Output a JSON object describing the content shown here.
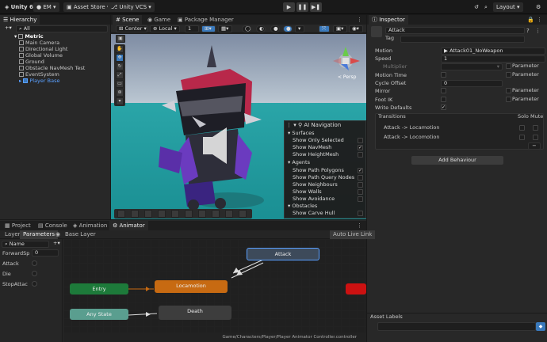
{
  "topbar": {
    "unity": "Unity 6",
    "account": "EM",
    "asset_store": "Asset Store",
    "vcs": "Unity VCS",
    "layout": "Layout"
  },
  "hierarchy": {
    "tab": "Hierarchy",
    "search_placeholder": "All",
    "root": "Metric",
    "items": [
      "Main Camera",
      "Directional Light",
      "Global Volume",
      "Ground",
      "Obstacle NavMesh Test",
      "EventSystem"
    ],
    "selected": "Player Base"
  },
  "scene": {
    "tabs": [
      "Scene",
      "Game",
      "Package Manager"
    ],
    "pivot": "Center",
    "space": "Local",
    "snap": "1",
    "persp": "< Persp"
  },
  "ai_navigation": {
    "title": "AI Navigation",
    "surfaces_header": "Surfaces",
    "surfaces": [
      {
        "label": "Show Only Selected",
        "checked": false
      },
      {
        "label": "Show NavMesh",
        "checked": true
      },
      {
        "label": "Show HeightMesh",
        "checked": false
      }
    ],
    "agents_header": "Agents",
    "agents": [
      {
        "label": "Show Path Polygons",
        "checked": true
      },
      {
        "label": "Show Path Query Nodes",
        "checked": false
      },
      {
        "label": "Show Neighbours",
        "checked": false
      },
      {
        "label": "Show Walls",
        "checked": false
      },
      {
        "label": "Show Avoidance",
        "checked": false
      }
    ],
    "obstacles_header": "Obstacles",
    "obstacles": [
      {
        "label": "Show Carve Hull",
        "checked": false
      }
    ]
  },
  "inspector": {
    "tab": "Inspector",
    "name": "Attack",
    "tag_label": "Tag",
    "motion_label": "Motion",
    "motion_value": "Attack01_NoWeapon",
    "speed_label": "Speed",
    "speed_value": "1",
    "multiplier_label": "Multiplier",
    "motion_time_label": "Motion Time",
    "mirror_label": "Mirror",
    "cycle_offset_label": "Cycle Offset",
    "cycle_offset_value": "0",
    "foot_ik_label": "Foot IK",
    "write_defaults_label": "Write Defaults",
    "parameter": "Parameter",
    "transitions_label": "Transitions",
    "solo_label": "Solo",
    "mute_label": "Mute",
    "transitions": [
      "Attack -> Locamotion",
      "Attack -> Locomotion"
    ],
    "add_behaviour": "Add Behaviour",
    "asset_labels": "Asset Labels"
  },
  "bottom": {
    "tabs": [
      "Project",
      "Console",
      "Animation",
      "Animator"
    ],
    "subtabs": [
      "Layers",
      "Parameters"
    ],
    "base_layer": "Base Layer",
    "auto_live_link": "Auto Live Link",
    "search_placeholder": "Name",
    "params": [
      {
        "name": "ForwardSp",
        "value": "0"
      },
      {
        "name": "Attack",
        "value": ""
      },
      {
        "name": "Die",
        "value": ""
      },
      {
        "name": "StopAttac",
        "value": ""
      }
    ],
    "nodes": {
      "attack": "Attack",
      "locamotion": "Locamotion",
      "entry": "Entry",
      "any_state": "Any State",
      "death": "Death"
    },
    "path": "Game/Characters/Player/Player Animator Controller.controller"
  },
  "colors": {
    "accent": "#3a79bb",
    "entry": "#1d7a3a",
    "locamotion": "#c76a12",
    "any_state": "#5a9e8f",
    "node": "#3d3d3d"
  }
}
